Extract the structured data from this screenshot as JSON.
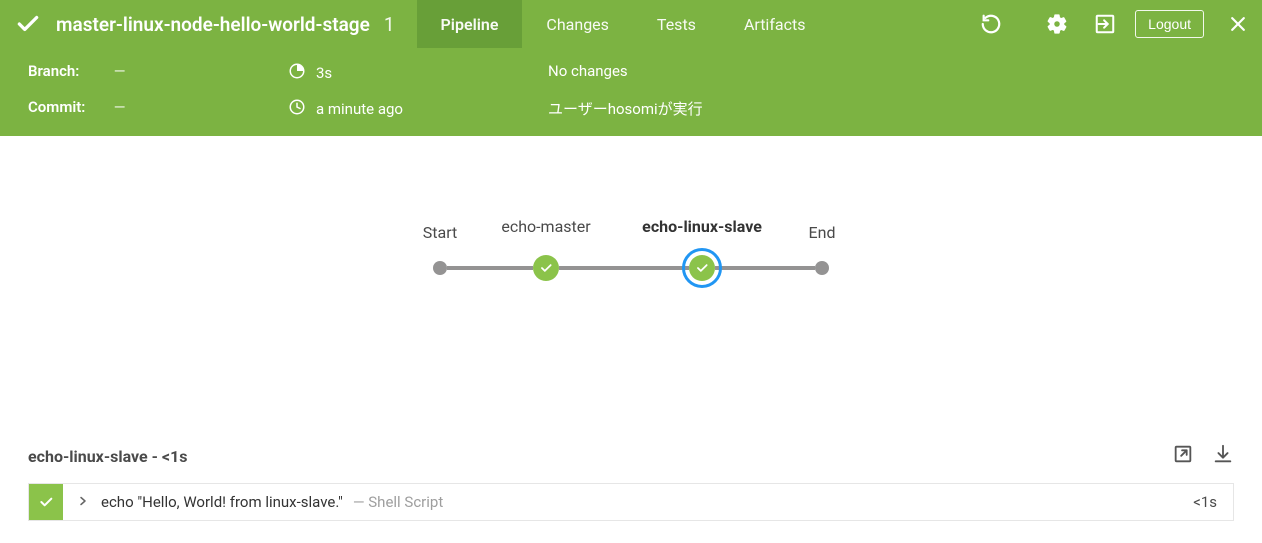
{
  "header": {
    "title": "master-linux-node-hello-world-stage",
    "run_number": "1",
    "tabs": [
      "Pipeline",
      "Changes",
      "Tests",
      "Artifacts"
    ],
    "active_tab": 0,
    "logout": "Logout"
  },
  "info": {
    "branch_label": "Branch:",
    "branch_value": "—",
    "commit_label": "Commit:",
    "commit_value": "—",
    "duration": "3s",
    "finished": "a minute ago",
    "changes": "No changes",
    "cause": "ユーザーhosomiが実行"
  },
  "pipeline": {
    "stages": [
      {
        "label": "Start",
        "kind": "dot",
        "selected": false
      },
      {
        "label": "echo-master",
        "kind": "node",
        "selected": false
      },
      {
        "label": "echo-linux-slave",
        "kind": "node",
        "selected": true
      },
      {
        "label": "End",
        "kind": "dot",
        "selected": false
      }
    ]
  },
  "log": {
    "section_title": "echo-linux-slave - <1s",
    "row": {
      "command": "echo \"Hello, World! from linux-slave.\"",
      "meta": "— Shell Script",
      "duration": "<1s"
    }
  }
}
